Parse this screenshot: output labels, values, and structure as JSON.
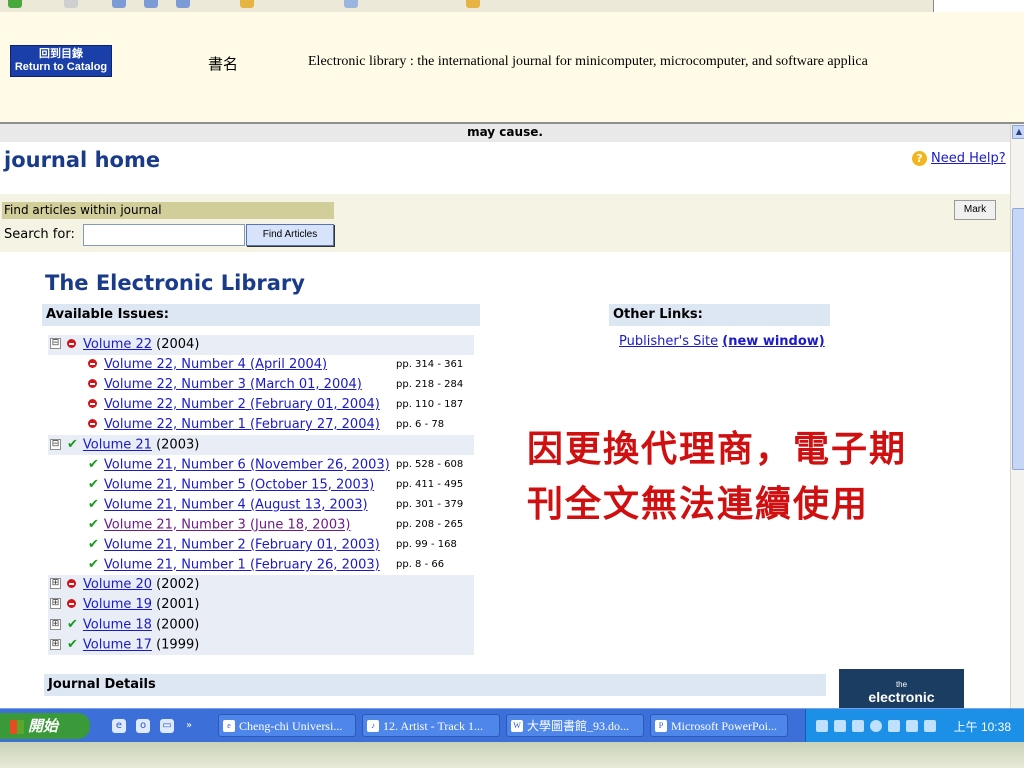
{
  "header": {
    "return_line1": "回到目錄",
    "return_line2": "Return to Catalog",
    "book_label": "書名",
    "book_title": "Electronic library : the international journal for minicomputer, microcomputer, and software applica"
  },
  "notice": "may cause.",
  "journal_home": "journal home",
  "need_help": "Need Help?",
  "search": {
    "find_label": "Find articles within journal",
    "search_for": "Search for:",
    "input_value": "",
    "button": "Find Articles",
    "mark": "Mark"
  },
  "library_title": "The Electronic Library",
  "available_issues": "Available Issues:",
  "other_links": "Other Links:",
  "publisher_site": "Publisher's Site",
  "new_window": "(new window)",
  "volumes": [
    {
      "link": "Volume 22",
      "year": "(2004)",
      "expanded": "⊟",
      "status": "red"
    },
    {
      "link": "Volume 21",
      "year": "(2003)",
      "expanded": "⊟",
      "status": "green"
    },
    {
      "link": "Volume 20",
      "year": "(2002)",
      "expanded": "⊞",
      "status": "red"
    },
    {
      "link": "Volume 19",
      "year": "(2001)",
      "expanded": "⊞",
      "status": "red"
    },
    {
      "link": "Volume 18",
      "year": "(2000)",
      "expanded": "⊞",
      "status": "green"
    },
    {
      "link": "Volume 17",
      "year": "(1999)",
      "expanded": "⊞",
      "status": "green"
    }
  ],
  "issues_v22": [
    {
      "label": "Volume 22, Number 4 (April 2004)",
      "pages": "pp. 314 - 361"
    },
    {
      "label": "Volume 22, Number 3 (March 01, 2004)",
      "pages": "pp. 218 - 284"
    },
    {
      "label": "Volume 22, Number 2 (February 01, 2004)",
      "pages": "pp. 110 - 187"
    },
    {
      "label": "Volume 22, Number 1 (February 27, 2004)",
      "pages": "pp. 6 - 78"
    }
  ],
  "issues_v21": [
    {
      "label": "Volume 21, Number 6 (November 26, 2003)",
      "pages": "pp. 528 - 608"
    },
    {
      "label": "Volume 21, Number 5 (October 15, 2003)",
      "pages": "pp. 411 - 495"
    },
    {
      "label": "Volume 21, Number 4 (August 13, 2003)",
      "pages": "pp. 301 - 379"
    },
    {
      "label": "Volume 21, Number 3 (June 18, 2003)",
      "pages": "pp. 208 - 265"
    },
    {
      "label": "Volume 21, Number 2 (February 01, 2003)",
      "pages": "pp. 99 - 168"
    },
    {
      "label": "Volume 21, Number 1 (February 26, 2003)",
      "pages": "pp. 8 - 66"
    }
  ],
  "red_message_line1": "因更換代理商，電子期",
  "red_message_line2": "刊全文無法連續使用",
  "journal_details": "Journal Details",
  "cover": {
    "small": "the",
    "big": "electronic"
  },
  "taskbar": {
    "start": "開始",
    "tasks": [
      "Cheng-chi Universi...",
      "12. Artist - Track 1...",
      "大學圖書館_93.do...",
      "Microsoft PowerPoi..."
    ],
    "clock": "上午 10:38"
  },
  "colors": {
    "link": "#1a1ac8",
    "visited": "#6d1a8c",
    "heading_blue": "#1a3b8a",
    "alert_red": "#d01010",
    "status_red": "#d0141a",
    "status_green": "#189a1a"
  }
}
